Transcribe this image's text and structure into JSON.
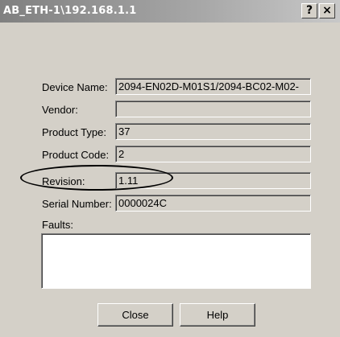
{
  "window": {
    "title": "AB_ETH-1\\192.168.1.1",
    "help_glyph": "?",
    "close_glyph": "×"
  },
  "fields": [
    {
      "label": "Device Name:",
      "value": "2094-EN02D-M01S1/2094-BC02-M02-"
    },
    {
      "label": "Vendor:",
      "value": ""
    },
    {
      "label": "Product Type:",
      "value": "37"
    },
    {
      "label": "Product Code:",
      "value": "2"
    },
    {
      "label": "Revision:",
      "value": "1.11"
    },
    {
      "label": "Serial Number:",
      "value": "0000024C"
    }
  ],
  "faults": {
    "label": "Faults:",
    "value": ""
  },
  "buttons": {
    "close_label": "Close",
    "help_label": "Help"
  },
  "annotation": {
    "shape": "ellipse",
    "color": "#000000",
    "target": "Revision"
  }
}
